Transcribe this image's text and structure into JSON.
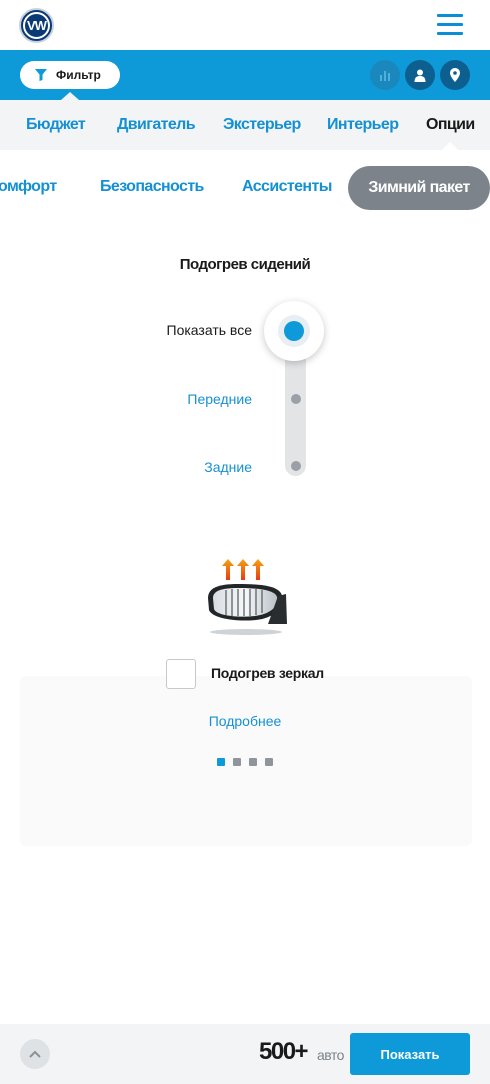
{
  "header": {
    "logo_text": "VW",
    "menu_icon": "hamburger-icon"
  },
  "filter_bar": {
    "filter_label": "Фильтр",
    "filter_icon": "funnel-icon",
    "actions": [
      "chart-icon",
      "user-icon",
      "location-pin-icon"
    ]
  },
  "tabs": [
    {
      "label": "Бюджет",
      "active": false
    },
    {
      "label": "Двигатель",
      "active": false
    },
    {
      "label": "Экстерьер",
      "active": false
    },
    {
      "label": "Интерьер",
      "active": false
    },
    {
      "label": "Опции",
      "active": true
    }
  ],
  "subtabs": [
    {
      "label": "омфорт",
      "active": false
    },
    {
      "label": "Безопасность",
      "active": false
    },
    {
      "label": "Ассистенты",
      "active": false
    },
    {
      "label": "Зимний пакет",
      "active": true
    }
  ],
  "seat_heating": {
    "title": "Подогрев сидений",
    "options": [
      "Показать все",
      "Передние",
      "Задние"
    ],
    "selected": "Показать все"
  },
  "mirror_heating": {
    "image_icon": "heated-mirror-icon",
    "label": "Подогрев зеркал",
    "checked": false,
    "more_link": "Подробнее"
  },
  "pagination": {
    "pages": 4,
    "current": 1
  },
  "bottom_bar": {
    "count": "500+",
    "count_unit": "авто",
    "show_button": "Показать",
    "scroll_up_icon": "chevron-up-icon"
  },
  "colors": {
    "accent": "#0e9ad8",
    "link": "#1591d3",
    "active_chip": "#7c838a"
  }
}
